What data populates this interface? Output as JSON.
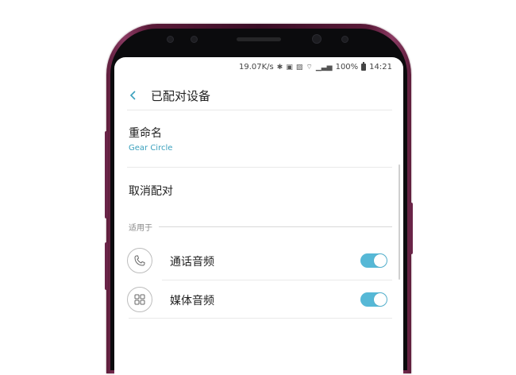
{
  "status_bar": {
    "net_speed": "19.07K/s",
    "battery": "100%",
    "time": "14:21"
  },
  "header": {
    "title": "已配对设备"
  },
  "rename": {
    "label": "重命名",
    "device_name": "Gear Circle"
  },
  "unpair": {
    "label": "取消配对"
  },
  "section": {
    "label": "适用于"
  },
  "profiles": [
    {
      "label": "通话音频",
      "icon": "phone-icon",
      "enabled": true
    },
    {
      "label": "媒体音频",
      "icon": "media-grid-icon",
      "enabled": true
    }
  ],
  "colors": {
    "accent": "#56b8d6",
    "subtitle": "#3aa0bd",
    "phone_frame": "#5a1a38"
  }
}
